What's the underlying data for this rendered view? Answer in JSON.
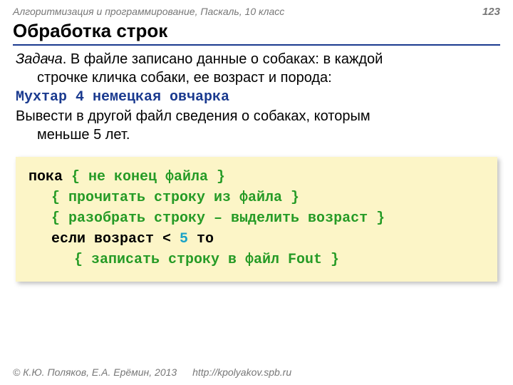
{
  "header": {
    "breadcrumb": "Алгоритмизация и программирование, Паскаль, 10 класс",
    "page": "123"
  },
  "title": "Обработка строк",
  "task": {
    "label": "Задача",
    "line1_tail": ". В файле записано данные о собаках: в каждой",
    "line2": "строчке кличка собаки, ее возраст и порода:",
    "example": "Мухтар 4 немецкая овчарка",
    "line3": "Вывести в другой файл сведения о собаках, которым",
    "line4": "меньше 5 лет."
  },
  "code": {
    "l1_kw": "пока ",
    "l1_cmt": "{ не конец файла }",
    "l2_cmt": "{ прочитать строку из файла }",
    "l3_cmt": "{ разобрать строку – выделить возраст }",
    "l4_kw1": "если возраст < ",
    "l4_num": "5",
    "l4_kw2": " то",
    "l5_cmt": "{ записать строку в файл Fout }"
  },
  "footer": {
    "copyright": "© К.Ю. Поляков, Е.А. Ерёмин, 2013",
    "url": "http://kpolyakov.spb.ru"
  }
}
